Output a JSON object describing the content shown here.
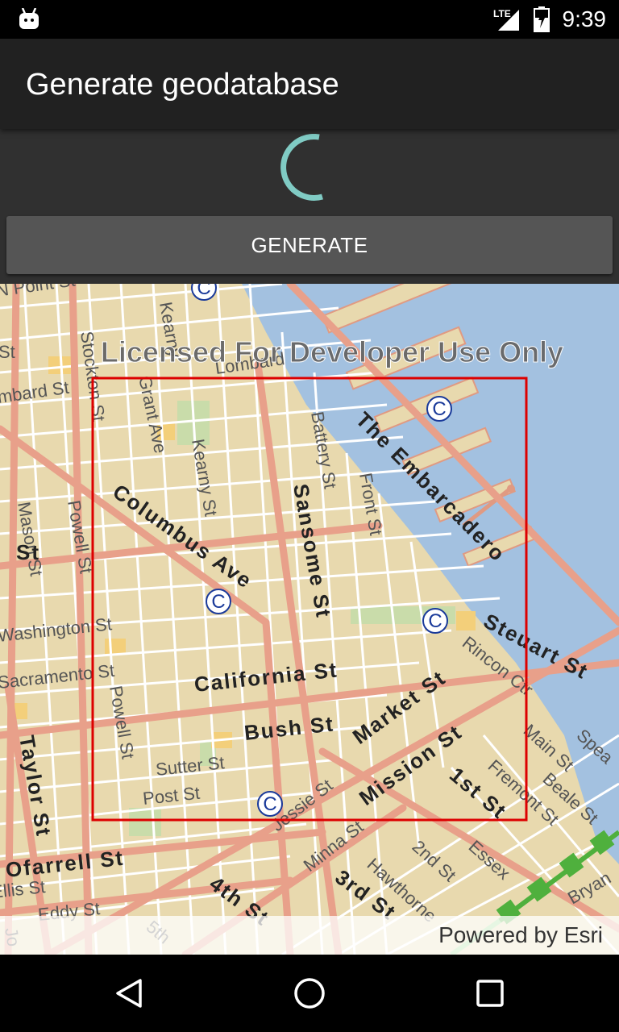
{
  "status_bar": {
    "network": "LTE",
    "time": "9:39"
  },
  "app_bar": {
    "title": "Generate geodatabase"
  },
  "actions": {
    "generate_label": "GENERATE"
  },
  "map": {
    "watermark": "Licensed For Developer Use Only",
    "attribution": "Powered by Esri",
    "marker_symbol": "C",
    "streets": {
      "n_point": "N Point St",
      "lombard": "Lombard",
      "lombard_st": "mbard St",
      "stockton": "Stockton St",
      "grant": "Grant Ave",
      "kearny": "Kearny St",
      "kearny_top": "Kearny",
      "battery": "Battery St",
      "front": "Front St",
      "embarcadero": "The Embarcadero",
      "columbus": "Columbus Ave",
      "sansome": "Sansome St",
      "mason": "Mason St",
      "powell": "Powell St",
      "washington": "Washington St",
      "sacramento": "Sacramento St",
      "california": "California St",
      "steuart": "Steuart St",
      "rincon": "Rincon Ctr",
      "market": "Market St",
      "bush": "Bush St",
      "powell_lower": "Powell St",
      "sutter": "Sutter St",
      "post": "Post St",
      "mission": "Mission St",
      "first": "1st St",
      "fremont": "Fremont St",
      "main": "Main St",
      "beale": "Beale St",
      "spear": "Spea",
      "taylor": "Taylor St",
      "ofarrell": "Ofarrell St",
      "jessie": "Jessie St",
      "minna": "Minna St",
      "second": "2nd St",
      "essex": "Essex",
      "hawthorne": "Hawthorne",
      "bryant": "Bryan",
      "fourth": "4th St",
      "third": "3rd St",
      "fifth": "5th",
      "eddy": "Eddy St",
      "ellis": "Ellis St",
      "st_left": "St",
      "st_left2": "St",
      "jones": "Jo"
    }
  },
  "colors": {
    "land": "#e8d9ae",
    "water": "#a3c1e0",
    "major_road": "#e8a08a",
    "minor_road": "#ffffff",
    "park": "#c9dcaa",
    "extent_box": "#dd0000",
    "rail": "#4fb03d",
    "spinner": "#80cbc4"
  }
}
